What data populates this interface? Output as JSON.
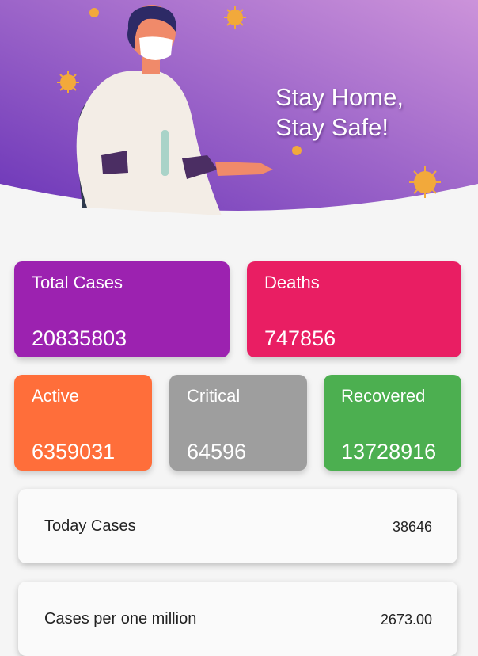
{
  "hero": {
    "line1": "Stay Home,",
    "line2": "Stay Safe!",
    "colors": {
      "gradient_start": "#7a3fc0",
      "gradient_end": "#c58ad8"
    }
  },
  "stats": {
    "total_cases": {
      "label": "Total Cases",
      "value": "20835803",
      "color": "#9c22b0"
    },
    "deaths": {
      "label": "Deaths",
      "value": "747856",
      "color": "#e91e63"
    },
    "active": {
      "label": "Active",
      "value": "6359031",
      "color": "#ff6e3a"
    },
    "critical": {
      "label": "Critical",
      "value": "64596",
      "color": "#9e9e9e"
    },
    "recovered": {
      "label": "Recovered",
      "value": "13728916",
      "color": "#4caf50"
    }
  },
  "details": [
    {
      "label": "Today Cases",
      "value": "38646"
    },
    {
      "label": "Cases per one million",
      "value": "2673.00"
    }
  ]
}
